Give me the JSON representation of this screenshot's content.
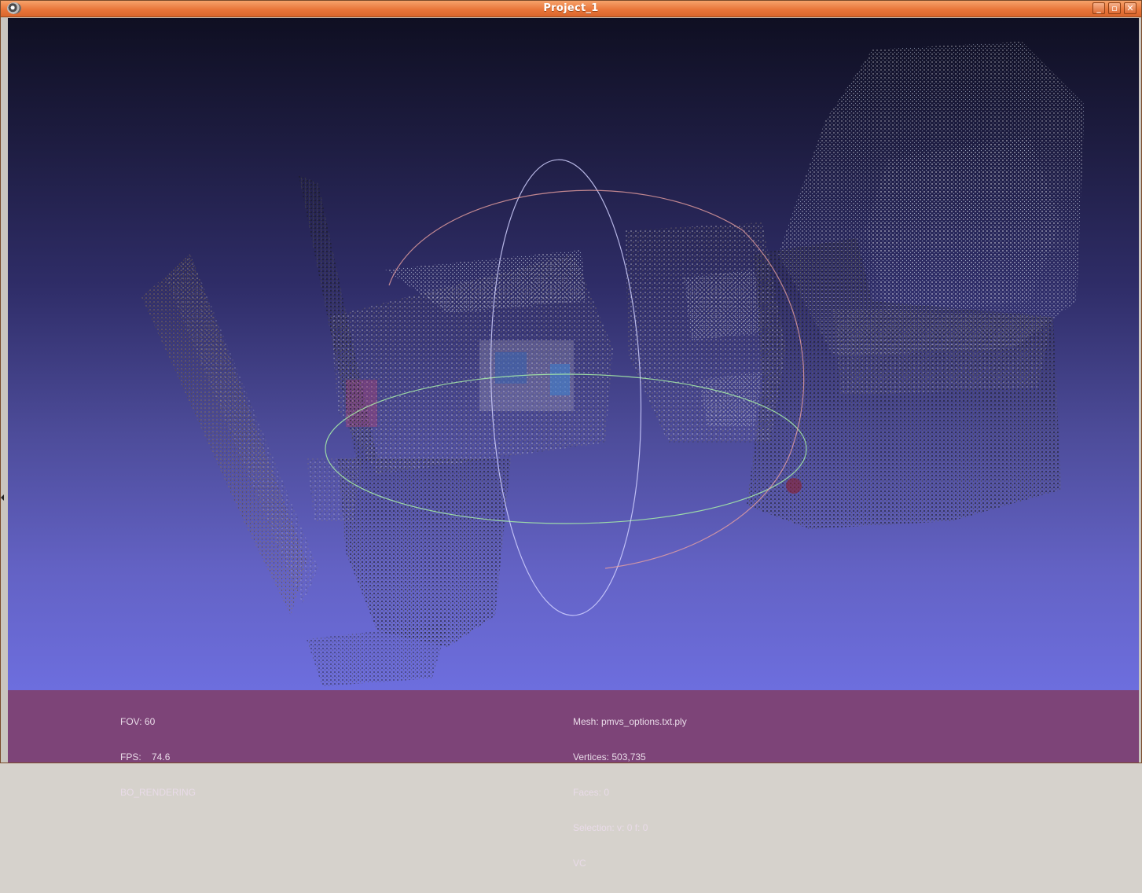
{
  "window": {
    "title": "Project_1",
    "controls": {
      "minimize": "_",
      "maximize": "▫",
      "close": "✕"
    }
  },
  "viewport": {
    "content": "3D point cloud of a room interior with trackball rotation gizmo",
    "colors": {
      "background_top": "#0f0f22",
      "background_bottom": "#6d6ede",
      "gizmo_red": "#e8a0a0",
      "gizmo_blue": "#c8c8ff",
      "gizmo_green": "#a8f0a8"
    }
  },
  "info_left": {
    "fov": "FOV: 60",
    "fps": "FPS:    74.6",
    "rendering": "BO_RENDERING"
  },
  "info_right": {
    "mesh": "Mesh: pmvs_options.txt.ply",
    "vertices": "Vertices: 503,735",
    "faces": "Faces: 0",
    "selection": "Selection: v: 0 f: 0",
    "color_mode": "VC"
  }
}
